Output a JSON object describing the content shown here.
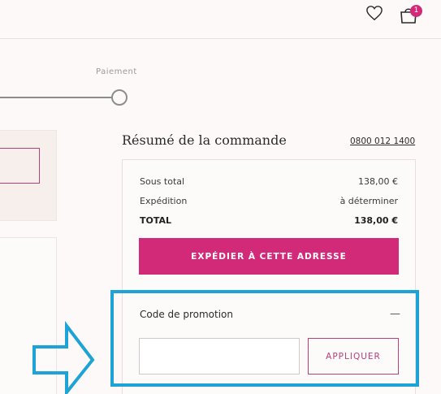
{
  "header": {
    "wishlist_icon": "heart-icon",
    "cart_icon": "shopping-bag-icon",
    "cart_count": "1",
    "accent_color": "#d22a79"
  },
  "stepper": {
    "current_step_label": "Paiement"
  },
  "summary": {
    "title": "Résumé de la commande",
    "phone": "0800 012 1400",
    "rows": [
      {
        "label": "Sous total",
        "value": "138,00 €"
      },
      {
        "label": "Expédition",
        "value": "à déterminer"
      },
      {
        "label": "TOTAL",
        "value": "138,00 €"
      }
    ],
    "ship_button": "EXPÉDIER À CETTE ADRESSE"
  },
  "promo": {
    "label": "Code de promotion",
    "toggle": "—",
    "input_value": "",
    "apply_button": "APPLIQUER"
  },
  "annotation": {
    "highlight_color": "#1ea3d6",
    "arrow_icon": "right-arrow-outline-icon"
  }
}
